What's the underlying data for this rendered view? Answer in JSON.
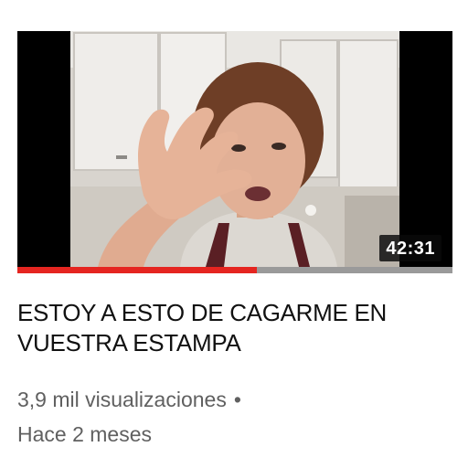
{
  "video": {
    "duration": "42:31",
    "watched_fraction": 0.55,
    "title": "ESTOY A ESTO DE CAGARME EN VUESTRA ESTAMPA",
    "views": "3,9 mil visualizaciones",
    "separator": "•",
    "age": "Hace 2 meses"
  },
  "colors": {
    "progress_played": "#e52520",
    "progress_track": "#9a9a9a",
    "meta_text": "#606060",
    "title_text": "#111111"
  }
}
